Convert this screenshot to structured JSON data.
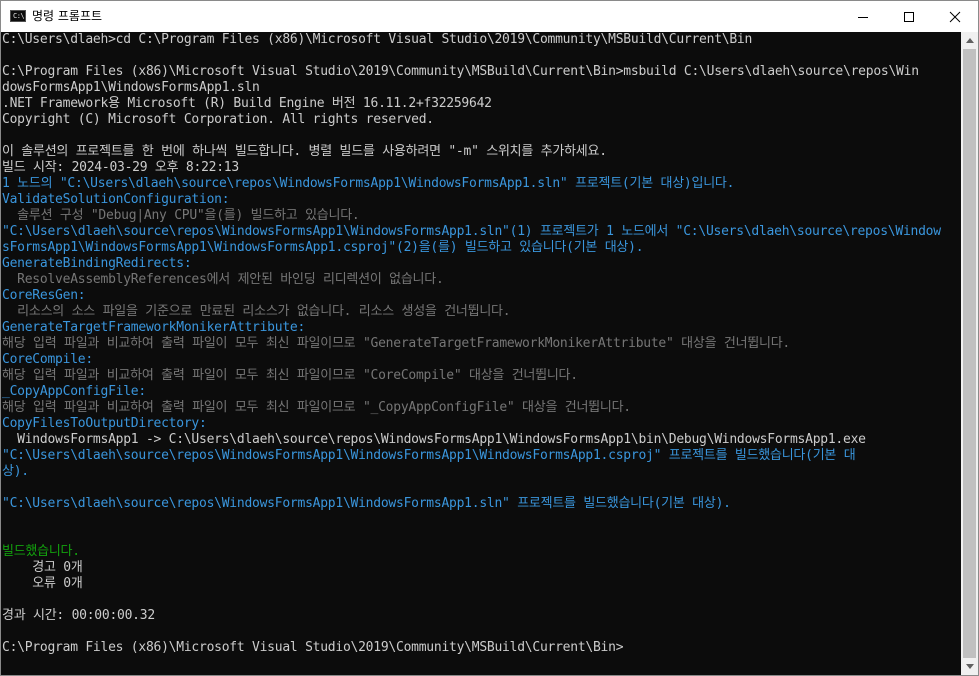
{
  "window": {
    "title": "명령 프롬프트",
    "icon_label": "C:\\"
  },
  "icons": {
    "app": "cmd-icon",
    "minimize": "minimize-icon",
    "maximize": "maximize-icon",
    "close": "close-icon",
    "scroll_up": "scroll-up-icon",
    "scroll_down": "scroll-down-icon"
  },
  "colors": {
    "background": "#0c0c0c",
    "text": "#cccccc",
    "cyan": "#3a96dd",
    "dim": "#767676",
    "green": "#13a10e"
  },
  "console": {
    "lines": [
      "C:\\Users\\dlaeh>cd C:\\Program Files (x86)\\Microsoft Visual Studio\\2019\\Community\\MSBuild\\Current\\Bin",
      "",
      "C:\\Program Files (x86)\\Microsoft Visual Studio\\2019\\Community\\MSBuild\\Current\\Bin>msbuild C:\\Users\\dlaeh\\source\\repos\\Win",
      "dowsFormsApp1\\WindowsFormsApp1.sln",
      ".NET Framework용 Microsoft (R) Build Engine 버전 16.11.2+f32259642",
      "Copyright (C) Microsoft Corporation. All rights reserved.",
      "",
      "이 솔루션의 프로젝트를 한 번에 하나씩 빌드합니다. 병렬 빌드를 사용하려면 \"-m\" 스위치를 추가하세요.",
      "빌드 시작: 2024-03-29 오후 8:22:13",
      "1 노드의 \"C:\\Users\\dlaeh\\source\\repos\\WindowsFormsApp1\\WindowsFormsApp1.sln\" 프로젝트(기본 대상)입니다.",
      "ValidateSolutionConfiguration:",
      "  솔루션 구성 \"Debug|Any CPU\"을(를) 빌드하고 있습니다.",
      "\"C:\\Users\\dlaeh\\source\\repos\\WindowsFormsApp1\\WindowsFormsApp1.sln\"(1) 프로젝트가 1 노드에서 \"C:\\Users\\dlaeh\\source\\repos\\Window",
      "sFormsApp1\\WindowsFormsApp1\\WindowsFormsApp1.csproj\"(2)을(를) 빌드하고 있습니다(기본 대상).",
      "GenerateBindingRedirects:",
      "  ResolveAssemblyReferences에서 제안된 바인딩 리디렉션이 없습니다.",
      "CoreResGen:",
      "  리소스의 소스 파일을 기준으로 만료된 리소스가 없습니다. 리소스 생성을 건너뜁니다.",
      "GenerateTargetFrameworkMonikerAttribute:",
      "해당 입력 파일과 비교하여 출력 파일이 모두 최신 파일이므로 \"GenerateTargetFrameworkMonikerAttribute\" 대상을 건너뜁니다.",
      "CoreCompile:",
      "해당 입력 파일과 비교하여 출력 파일이 모두 최신 파일이므로 \"CoreCompile\" 대상을 건너뜁니다.",
      "_CopyAppConfigFile:",
      "해당 입력 파일과 비교하여 출력 파일이 모두 최신 파일이므로 \"_CopyAppConfigFile\" 대상을 건너뜁니다.",
      "CopyFilesToOutputDirectory:",
      "  WindowsFormsApp1 -> C:\\Users\\dlaeh\\source\\repos\\WindowsFormsApp1\\WindowsFormsApp1\\bin\\Debug\\WindowsFormsApp1.exe",
      "\"C:\\Users\\dlaeh\\source\\repos\\WindowsFormsApp1\\WindowsFormsApp1\\WindowsFormsApp1.csproj\" 프로젝트를 빌드했습니다(기본 대",
      "상).",
      "",
      "\"C:\\Users\\dlaeh\\source\\repos\\WindowsFormsApp1\\WindowsFormsApp1.sln\" 프로젝트를 빌드했습니다(기본 대상).",
      "",
      "",
      "빌드했습니다.",
      "    경고 0개",
      "    오류 0개",
      "",
      "경과 시간: 00:00:00.32",
      "",
      "C:\\Program Files (x86)\\Microsoft Visual Studio\\2019\\Community\\MSBuild\\Current\\Bin>"
    ]
  }
}
